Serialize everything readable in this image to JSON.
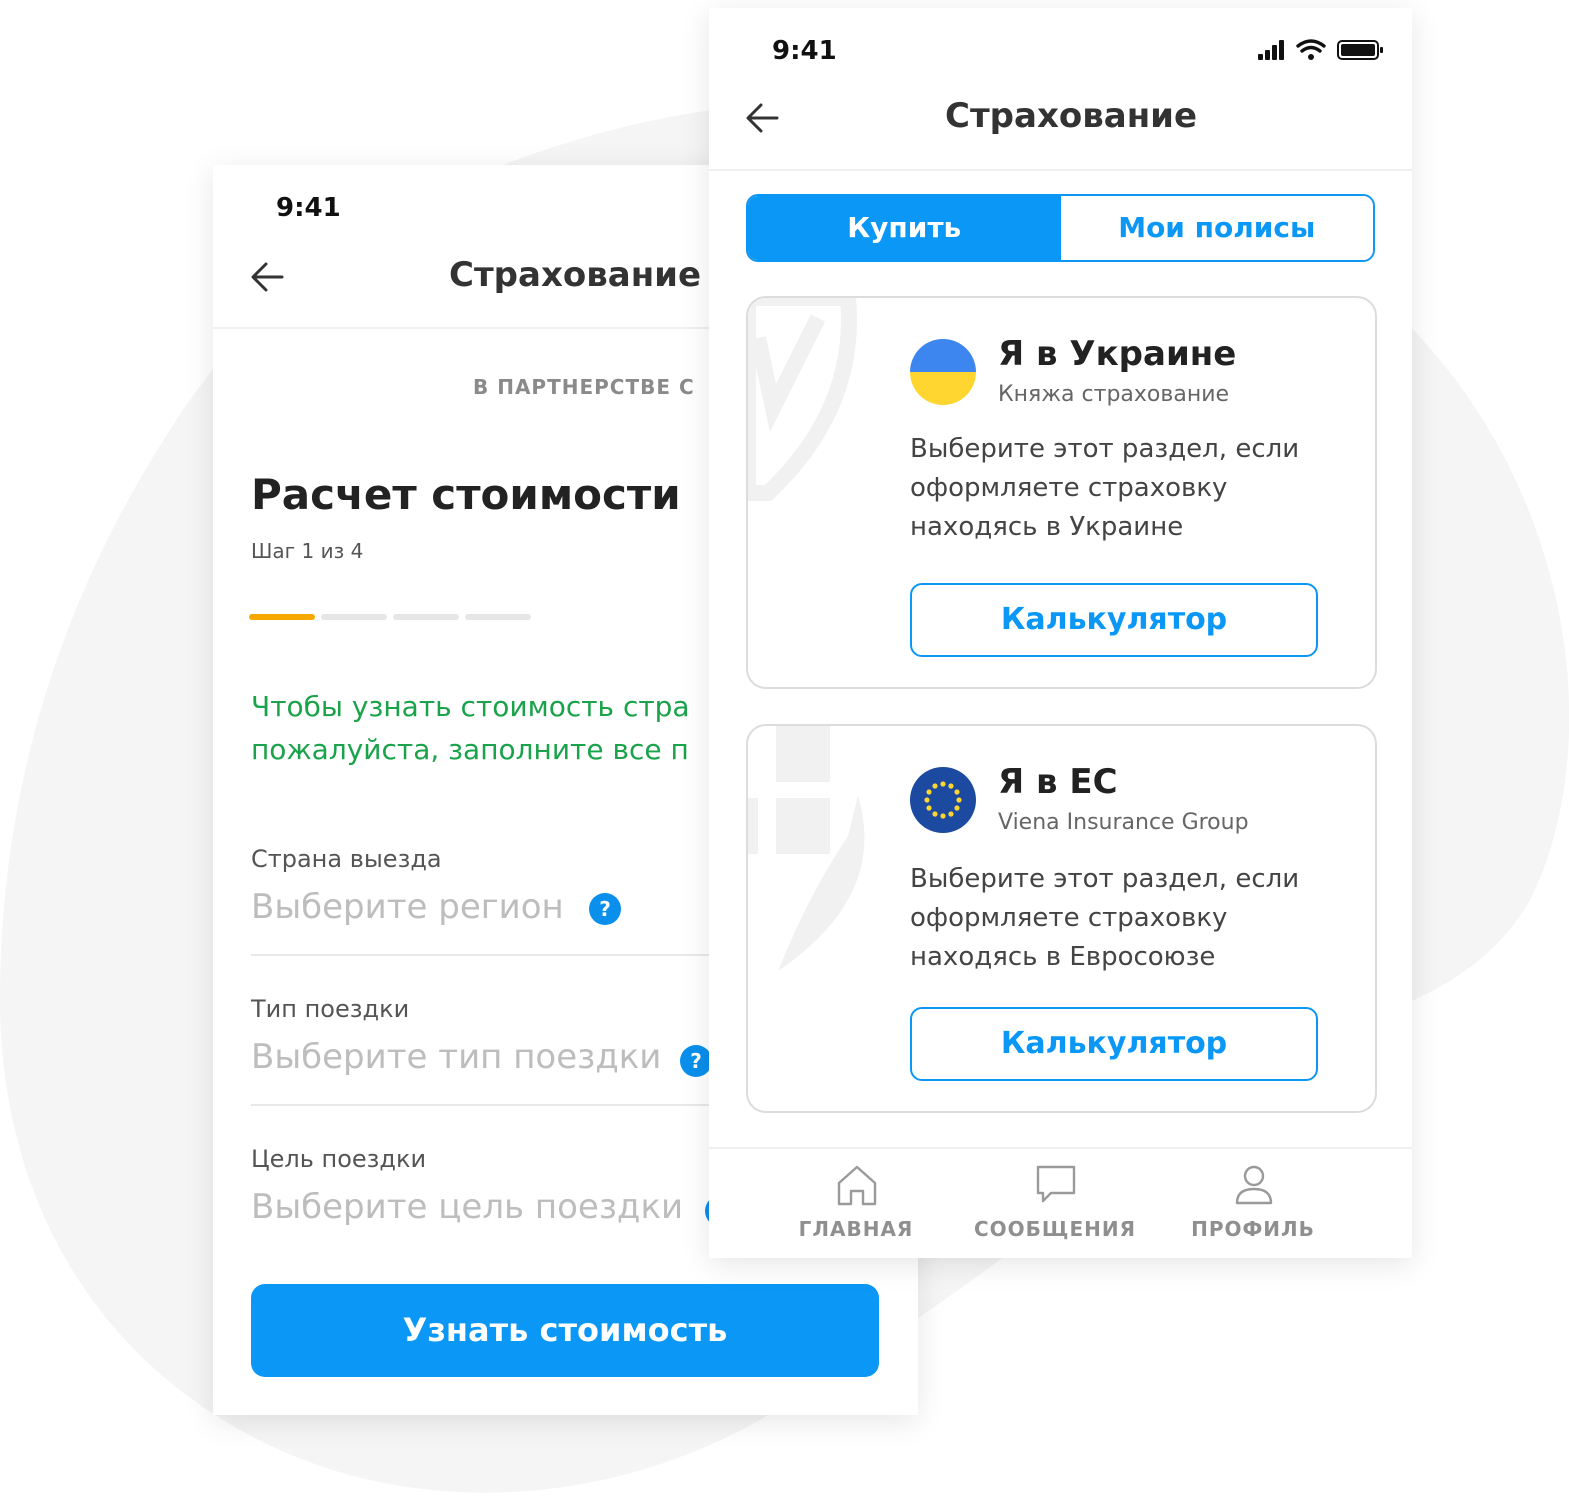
{
  "colors": {
    "accent": "#0a97f6",
    "help": "#0a8fec",
    "progress_active": "#f5a800",
    "info_text": "#1aa34a",
    "blob": "#f5f5f5"
  },
  "back_screen": {
    "status_time": "9:41",
    "header_title": "Страхование",
    "partner_text": "В ПАРТНЕРСТВЕ С",
    "title": "Расчет стоимости",
    "step_text": "Шаг 1 из 4",
    "progress": {
      "current_step": 1,
      "total_steps": 4
    },
    "info_line1": "Чтобы узнать стоимость стра",
    "info_line2": "пожалуйста, заполните все п",
    "fields": [
      {
        "label": "Страна выезда",
        "placeholder": "Выберите регион",
        "help_icon": "?"
      },
      {
        "label": "Тип поездки",
        "placeholder": "Выберите тип поездки",
        "help_icon": "?"
      },
      {
        "label": "Цель поездки",
        "placeholder": "Выберите цель поездки",
        "help_icon": "?"
      }
    ],
    "submit_label": "Узнать стоимость"
  },
  "front_screen": {
    "status_time": "9:41",
    "status_icons": [
      "signal-icon",
      "wifi-icon",
      "battery-icon"
    ],
    "header_title": "Страхование",
    "tabs": [
      {
        "label": "Купить",
        "active": true
      },
      {
        "label": "Мои полисы",
        "active": false
      }
    ],
    "cards": [
      {
        "flag_icon": "ukraine-flag-icon",
        "title": "Я в Украине",
        "subtitle": "Княжа страхование",
        "description": "Выберите этот раздел, если оформляете страховку находясь в Украине",
        "button_label": "Калькулятор"
      },
      {
        "flag_icon": "eu-flag-icon",
        "title": "Я в ЕС",
        "subtitle": "Viena Insurance Group",
        "description": "Выберите этот раздел, если оформляете страховку находясь в Евросоюзе",
        "button_label": "Калькулятор"
      }
    ],
    "bottom_nav": [
      {
        "icon": "home-icon",
        "label": "ГЛАВНАЯ"
      },
      {
        "icon": "chat-icon",
        "label": "СООБЩЕНИЯ"
      },
      {
        "icon": "user-icon",
        "label": "ПРОФИЛЬ"
      }
    ]
  }
}
